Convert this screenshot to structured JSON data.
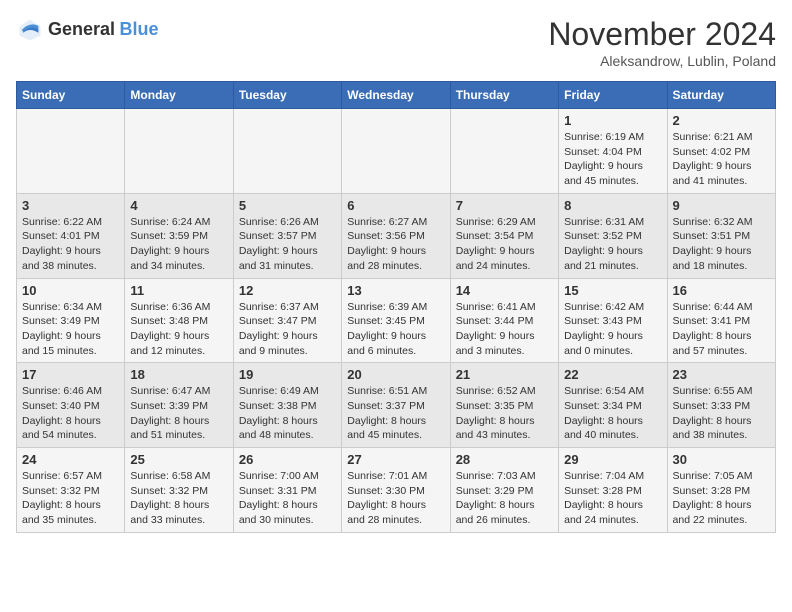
{
  "header": {
    "logo_general": "General",
    "logo_blue": "Blue",
    "month_title": "November 2024",
    "location": "Aleksandrow, Lublin, Poland"
  },
  "days_of_week": [
    "Sunday",
    "Monday",
    "Tuesday",
    "Wednesday",
    "Thursday",
    "Friday",
    "Saturday"
  ],
  "weeks": [
    [
      {
        "day": "",
        "info": ""
      },
      {
        "day": "",
        "info": ""
      },
      {
        "day": "",
        "info": ""
      },
      {
        "day": "",
        "info": ""
      },
      {
        "day": "",
        "info": ""
      },
      {
        "day": "1",
        "info": "Sunrise: 6:19 AM\nSunset: 4:04 PM\nDaylight: 9 hours and 45 minutes."
      },
      {
        "day": "2",
        "info": "Sunrise: 6:21 AM\nSunset: 4:02 PM\nDaylight: 9 hours and 41 minutes."
      }
    ],
    [
      {
        "day": "3",
        "info": "Sunrise: 6:22 AM\nSunset: 4:01 PM\nDaylight: 9 hours and 38 minutes."
      },
      {
        "day": "4",
        "info": "Sunrise: 6:24 AM\nSunset: 3:59 PM\nDaylight: 9 hours and 34 minutes."
      },
      {
        "day": "5",
        "info": "Sunrise: 6:26 AM\nSunset: 3:57 PM\nDaylight: 9 hours and 31 minutes."
      },
      {
        "day": "6",
        "info": "Sunrise: 6:27 AM\nSunset: 3:56 PM\nDaylight: 9 hours and 28 minutes."
      },
      {
        "day": "7",
        "info": "Sunrise: 6:29 AM\nSunset: 3:54 PM\nDaylight: 9 hours and 24 minutes."
      },
      {
        "day": "8",
        "info": "Sunrise: 6:31 AM\nSunset: 3:52 PM\nDaylight: 9 hours and 21 minutes."
      },
      {
        "day": "9",
        "info": "Sunrise: 6:32 AM\nSunset: 3:51 PM\nDaylight: 9 hours and 18 minutes."
      }
    ],
    [
      {
        "day": "10",
        "info": "Sunrise: 6:34 AM\nSunset: 3:49 PM\nDaylight: 9 hours and 15 minutes."
      },
      {
        "day": "11",
        "info": "Sunrise: 6:36 AM\nSunset: 3:48 PM\nDaylight: 9 hours and 12 minutes."
      },
      {
        "day": "12",
        "info": "Sunrise: 6:37 AM\nSunset: 3:47 PM\nDaylight: 9 hours and 9 minutes."
      },
      {
        "day": "13",
        "info": "Sunrise: 6:39 AM\nSunset: 3:45 PM\nDaylight: 9 hours and 6 minutes."
      },
      {
        "day": "14",
        "info": "Sunrise: 6:41 AM\nSunset: 3:44 PM\nDaylight: 9 hours and 3 minutes."
      },
      {
        "day": "15",
        "info": "Sunrise: 6:42 AM\nSunset: 3:43 PM\nDaylight: 9 hours and 0 minutes."
      },
      {
        "day": "16",
        "info": "Sunrise: 6:44 AM\nSunset: 3:41 PM\nDaylight: 8 hours and 57 minutes."
      }
    ],
    [
      {
        "day": "17",
        "info": "Sunrise: 6:46 AM\nSunset: 3:40 PM\nDaylight: 8 hours and 54 minutes."
      },
      {
        "day": "18",
        "info": "Sunrise: 6:47 AM\nSunset: 3:39 PM\nDaylight: 8 hours and 51 minutes."
      },
      {
        "day": "19",
        "info": "Sunrise: 6:49 AM\nSunset: 3:38 PM\nDaylight: 8 hours and 48 minutes."
      },
      {
        "day": "20",
        "info": "Sunrise: 6:51 AM\nSunset: 3:37 PM\nDaylight: 8 hours and 45 minutes."
      },
      {
        "day": "21",
        "info": "Sunrise: 6:52 AM\nSunset: 3:35 PM\nDaylight: 8 hours and 43 minutes."
      },
      {
        "day": "22",
        "info": "Sunrise: 6:54 AM\nSunset: 3:34 PM\nDaylight: 8 hours and 40 minutes."
      },
      {
        "day": "23",
        "info": "Sunrise: 6:55 AM\nSunset: 3:33 PM\nDaylight: 8 hours and 38 minutes."
      }
    ],
    [
      {
        "day": "24",
        "info": "Sunrise: 6:57 AM\nSunset: 3:32 PM\nDaylight: 8 hours and 35 minutes."
      },
      {
        "day": "25",
        "info": "Sunrise: 6:58 AM\nSunset: 3:32 PM\nDaylight: 8 hours and 33 minutes."
      },
      {
        "day": "26",
        "info": "Sunrise: 7:00 AM\nSunset: 3:31 PM\nDaylight: 8 hours and 30 minutes."
      },
      {
        "day": "27",
        "info": "Sunrise: 7:01 AM\nSunset: 3:30 PM\nDaylight: 8 hours and 28 minutes."
      },
      {
        "day": "28",
        "info": "Sunrise: 7:03 AM\nSunset: 3:29 PM\nDaylight: 8 hours and 26 minutes."
      },
      {
        "day": "29",
        "info": "Sunrise: 7:04 AM\nSunset: 3:28 PM\nDaylight: 8 hours and 24 minutes."
      },
      {
        "day": "30",
        "info": "Sunrise: 7:05 AM\nSunset: 3:28 PM\nDaylight: 8 hours and 22 minutes."
      }
    ]
  ]
}
